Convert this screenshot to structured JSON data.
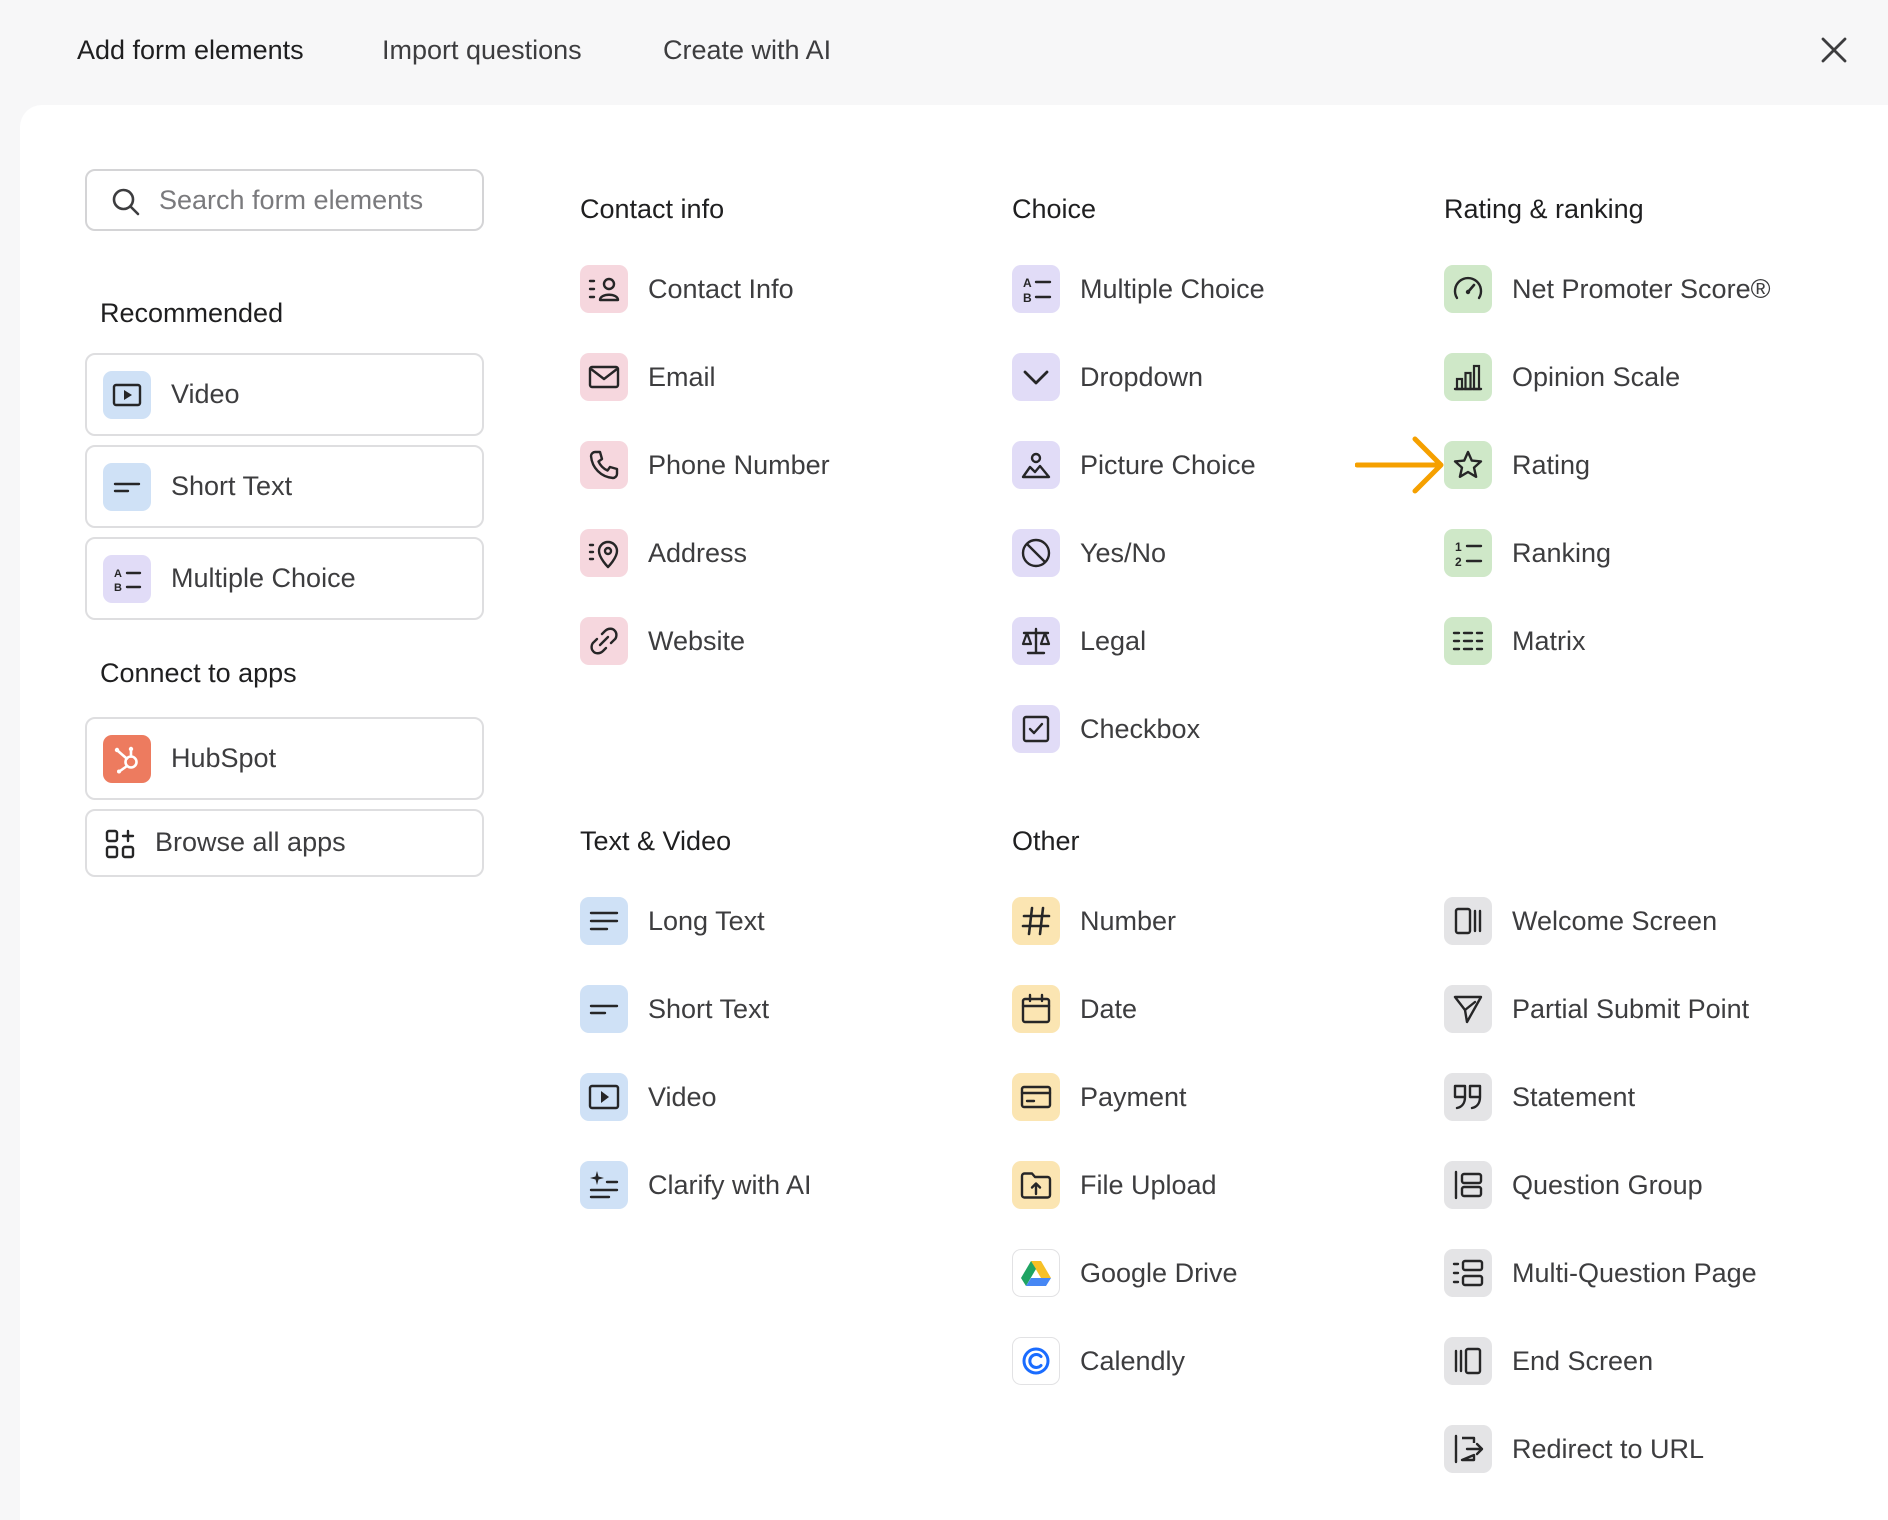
{
  "tabs": [
    {
      "label": "Add form elements"
    },
    {
      "label": "Import questions"
    },
    {
      "label": "Create with AI"
    }
  ],
  "search": {
    "placeholder": "Search form elements"
  },
  "sidebar": {
    "recommended_heading": "Recommended",
    "recommended": [
      {
        "label": "Video",
        "icon": "video-icon"
      },
      {
        "label": "Short Text",
        "icon": "short-text-icon"
      },
      {
        "label": "Multiple Choice",
        "icon": "multiple-choice-icon"
      }
    ],
    "apps_heading": "Connect to apps",
    "apps": [
      {
        "label": "HubSpot",
        "icon": "hubspot-icon"
      },
      {
        "label": "Browse all apps",
        "icon": "apps-grid-icon"
      }
    ]
  },
  "sections": {
    "contact": {
      "title": "Contact info",
      "items": [
        {
          "label": "Contact Info",
          "icon": "contact-info-icon"
        },
        {
          "label": "Email",
          "icon": "email-icon"
        },
        {
          "label": "Phone Number",
          "icon": "phone-icon"
        },
        {
          "label": "Address",
          "icon": "address-icon"
        },
        {
          "label": "Website",
          "icon": "link-icon"
        }
      ]
    },
    "choice": {
      "title": "Choice",
      "items": [
        {
          "label": "Multiple Choice",
          "icon": "multiple-choice-icon"
        },
        {
          "label": "Dropdown",
          "icon": "chevron-down-icon"
        },
        {
          "label": "Picture Choice",
          "icon": "picture-choice-icon"
        },
        {
          "label": "Yes/No",
          "icon": "yes-no-icon"
        },
        {
          "label": "Legal",
          "icon": "scale-icon"
        },
        {
          "label": "Checkbox",
          "icon": "checkbox-icon"
        }
      ]
    },
    "rating": {
      "title": "Rating & ranking",
      "items": [
        {
          "label": "Net Promoter Score®",
          "icon": "gauge-icon"
        },
        {
          "label": "Opinion Scale",
          "icon": "bar-chart-icon"
        },
        {
          "label": "Rating",
          "icon": "star-icon"
        },
        {
          "label": "Ranking",
          "icon": "ranking-icon"
        },
        {
          "label": "Matrix",
          "icon": "matrix-icon"
        }
      ]
    },
    "text_video": {
      "title": "Text & Video",
      "items": [
        {
          "label": "Long Text",
          "icon": "long-text-icon"
        },
        {
          "label": "Short Text",
          "icon": "short-text-icon"
        },
        {
          "label": "Video",
          "icon": "video-icon"
        },
        {
          "label": "Clarify with AI",
          "icon": "clarify-ai-icon"
        }
      ]
    },
    "other": {
      "title": "Other",
      "items": [
        {
          "label": "Number",
          "icon": "hash-icon"
        },
        {
          "label": "Date",
          "icon": "calendar-icon"
        },
        {
          "label": "Payment",
          "icon": "credit-card-icon"
        },
        {
          "label": "File Upload",
          "icon": "file-upload-icon"
        },
        {
          "label": "Google Drive",
          "icon": "google-drive-icon"
        },
        {
          "label": "Calendly",
          "icon": "calendly-icon"
        }
      ]
    },
    "screens": {
      "items": [
        {
          "label": "Welcome Screen",
          "icon": "welcome-screen-icon"
        },
        {
          "label": "Partial Submit Point",
          "icon": "send-icon"
        },
        {
          "label": "Statement",
          "icon": "quote-icon"
        },
        {
          "label": "Question Group",
          "icon": "question-group-icon"
        },
        {
          "label": "Multi-Question Page",
          "icon": "multi-question-icon"
        },
        {
          "label": "End Screen",
          "icon": "end-screen-icon"
        },
        {
          "label": "Redirect to URL",
          "icon": "redirect-icon"
        }
      ]
    }
  },
  "colors": {
    "contact": "#f6d7de",
    "choice": "#e1dcf7",
    "rating": "#cfe8c8",
    "text_video": "#cfe1f6",
    "other": "#fbe5b2",
    "screens": "#e4e4e6",
    "hubspot": "#ed7b5f",
    "annotation_arrow": "#f5a000"
  }
}
